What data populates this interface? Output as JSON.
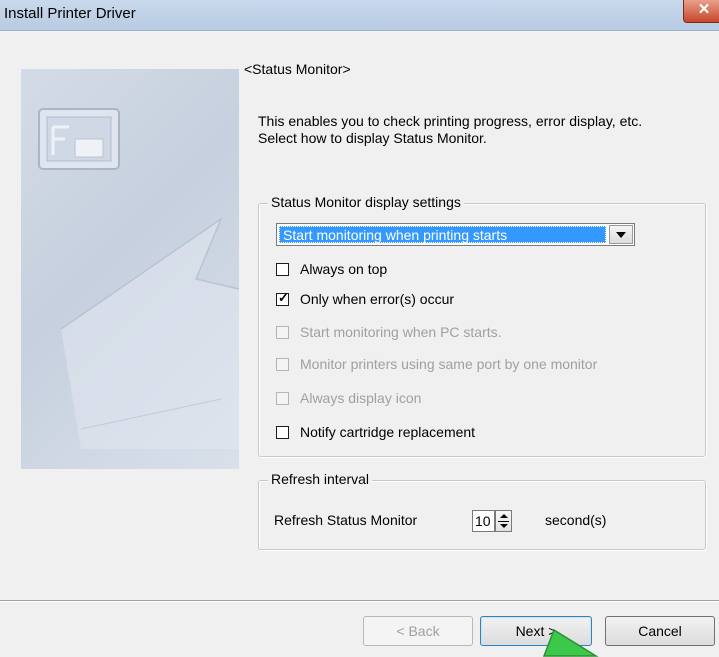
{
  "window": {
    "title": "Install Printer Driver",
    "close_label": "✕"
  },
  "header": "<Status Monitor>",
  "description": [
    "This enables you to check printing progress, error display, etc.",
    "Select how to display Status Monitor."
  ],
  "display_settings": {
    "legend": "Status Monitor display settings",
    "mode_selected": "Start monitoring when printing starts",
    "options": [
      {
        "label": "Always on top",
        "checked": false,
        "enabled": true
      },
      {
        "label": "Only when error(s) occur",
        "checked": true,
        "enabled": true
      },
      {
        "label": "Start monitoring when PC starts.",
        "checked": false,
        "enabled": false
      },
      {
        "label": "Monitor printers using same port by one monitor",
        "checked": false,
        "enabled": false
      },
      {
        "label": "Always display icon",
        "checked": false,
        "enabled": false
      },
      {
        "label": "Notify cartridge replacement",
        "checked": false,
        "enabled": true
      }
    ]
  },
  "refresh": {
    "legend": "Refresh interval",
    "label": "Refresh Status Monitor",
    "value": "10",
    "unit": "second(s)"
  },
  "buttons": {
    "back": "< Back",
    "next": "Next >",
    "cancel": "Cancel"
  },
  "colors": {
    "selection": "#3399ff",
    "titlebar": "#c9d9ec",
    "cursor": "#3cc94a"
  },
  "icons": {
    "close": "close-icon",
    "dropdown": "chevron-down-icon",
    "spinner": "spinner-arrows-icon",
    "cursor": "pointer-cursor-icon"
  }
}
